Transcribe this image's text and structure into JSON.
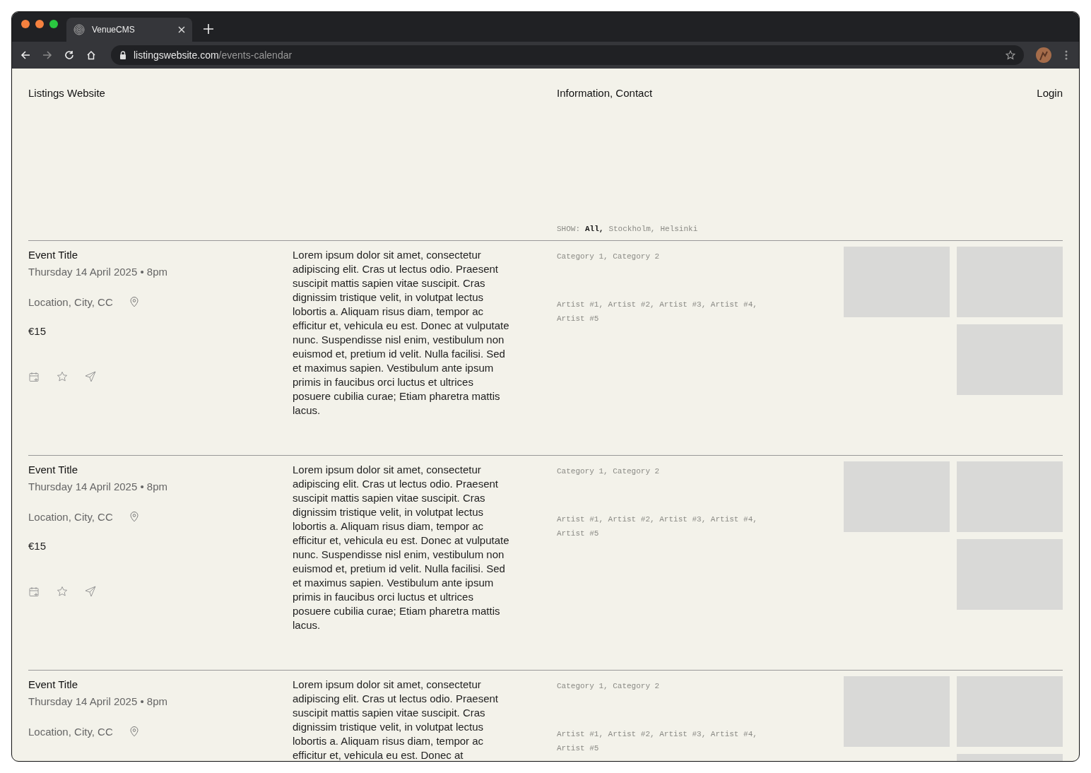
{
  "browser": {
    "tab": {
      "title": "VenueCMS",
      "selected": true
    },
    "url": {
      "host": "listingswebsite.com",
      "path": "/events-calendar"
    }
  },
  "header": {
    "site_title": "Listings Website",
    "nav": "Information, Contact",
    "login": "Login"
  },
  "filter": {
    "label": "SHOW:",
    "options": [
      {
        "label": "All,",
        "selected": true
      },
      {
        "label": "Stockholm,",
        "selected": false
      },
      {
        "label": "Helsinki",
        "selected": false
      }
    ]
  },
  "events": [
    {
      "title": "Event Title",
      "date": "Thursday 14 April 2025 • 8pm",
      "location": "Location, City, CC",
      "price": "€15",
      "description": "Lorem ipsum dolor sit amet, consectetur adipiscing elit. Cras ut lectus odio. Praesent suscipit mattis sapien vitae suscipit. Cras dignissim tristique velit, in volutpat lectus lobortis a. Aliquam risus diam, tempor ac efficitur et, vehicula eu est. Donec at vulputate nunc. Suspendisse nisl enim, vestibulum non euismod et, pretium id velit. Nulla facilisi. Sed et maximus sapien. Vestibulum ante ipsum primis in faucibus orci luctus et ultrices posuere cubilia curae; Etiam pharetra mattis lacus.",
      "categories": "Category 1, Category 2",
      "artists": "Artist #1, Artist #2, Artist #3, Artist #4, Artist #5"
    },
    {
      "title": "Event Title",
      "date": "Thursday 14 April 2025 • 8pm",
      "location": "Location, City, CC",
      "price": "€15",
      "description": "Lorem ipsum dolor sit amet, consectetur adipiscing elit. Cras ut lectus odio. Praesent suscipit mattis sapien vitae suscipit. Cras dignissim tristique velit, in volutpat lectus lobortis a. Aliquam risus diam, tempor ac efficitur et, vehicula eu est. Donec at vulputate nunc. Suspendisse nisl enim, vestibulum non euismod et, pretium id velit. Nulla facilisi. Sed et maximus sapien. Vestibulum ante ipsum primis in faucibus orci luctus et ultrices posuere cubilia curae; Etiam pharetra mattis lacus.",
      "categories": "Category 1, Category 2",
      "artists": "Artist #1, Artist #2, Artist #3, Artist #4, Artist #5"
    },
    {
      "title": "Event Title",
      "date": "Thursday 14 April 2025 • 8pm",
      "location": "Location, City, CC",
      "description": "Lorem ipsum dolor sit amet, consectetur adipiscing elit. Cras ut lectus odio. Praesent suscipit mattis sapien vitae suscipit. Cras dignissim tristique velit, in volutpat lectus lobortis a. Aliquam risus diam, tempor ac efficitur et, vehicula eu est. Donec at",
      "categories": "Category 1, Category 2",
      "artists": "Artist #1, Artist #2, Artist #3, Artist #4, Artist #5"
    }
  ]
}
